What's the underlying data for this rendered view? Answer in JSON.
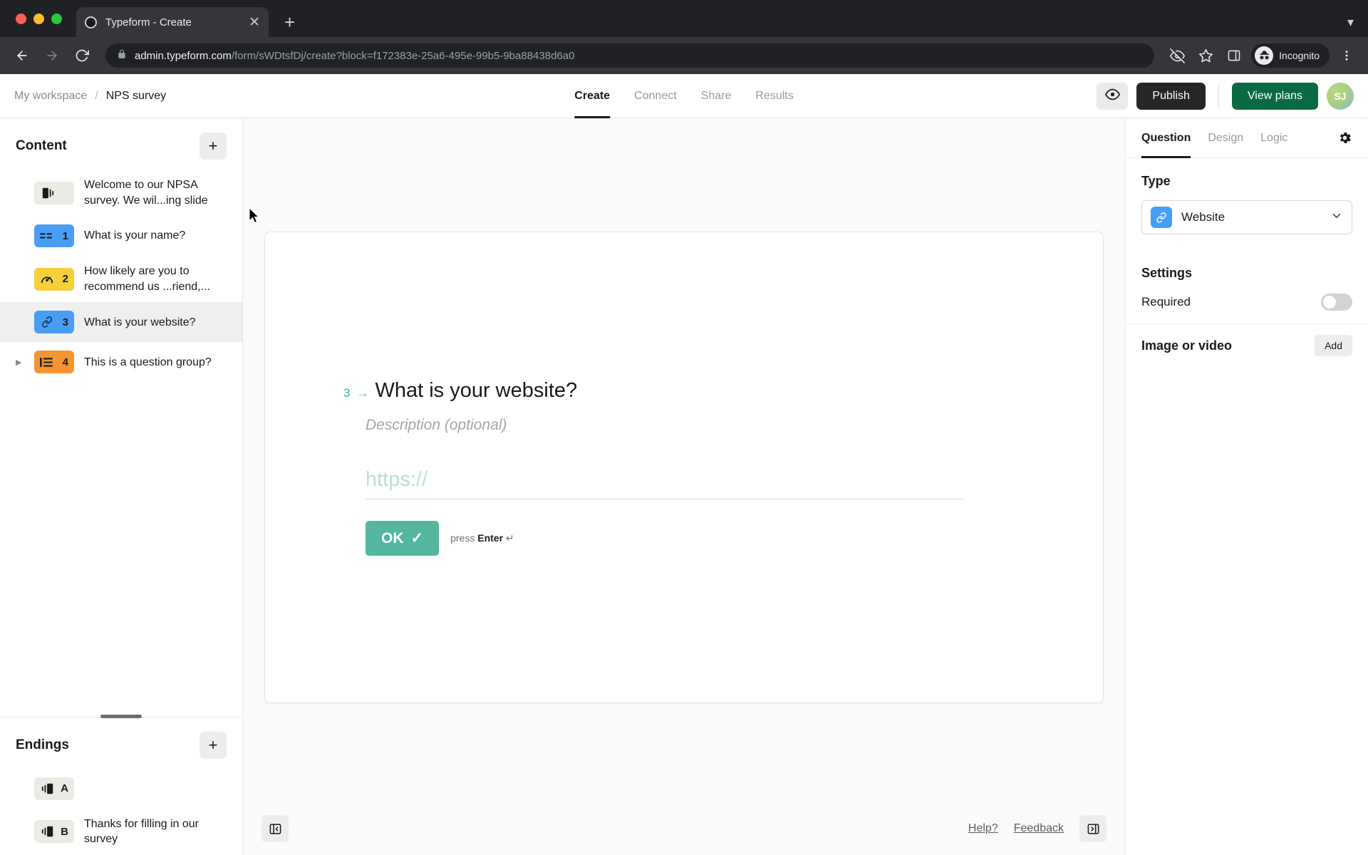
{
  "browser": {
    "tab_title": "Typeform - Create",
    "url_host": "admin.typeform.com",
    "url_path": "/form/sWDtsfDj/create?block=f172383e-25a6-495e-99b5-9ba88438d6a0",
    "profile_label": "Incognito",
    "icons": {
      "back": "back-arrow-icon",
      "forward": "forward-arrow-icon",
      "reload": "reload-icon",
      "lock": "lock-icon",
      "tracking_off": "eye-off-icon",
      "bookmark": "star-icon",
      "side_panel": "side-panel-icon",
      "menu": "kebab-menu-icon",
      "new_tab": "plus-icon",
      "close_tab": "close-icon",
      "tabstrip_menu": "chevron-down-icon"
    }
  },
  "header": {
    "breadcrumb_workspace": "My workspace",
    "breadcrumb_separator": "/",
    "breadcrumb_form": "NPS survey",
    "tabs": [
      {
        "label": "Create",
        "active": true
      },
      {
        "label": "Connect",
        "active": false
      },
      {
        "label": "Share",
        "active": false
      },
      {
        "label": "Results",
        "active": false
      }
    ],
    "preview_icon": "eye-icon",
    "publish_label": "Publish",
    "view_plans_label": "View plans",
    "avatar_initials": "SJ"
  },
  "sidebar": {
    "content_title": "Content",
    "add_label": "+",
    "content_items": [
      {
        "badge": "",
        "icon": "welcome-slide-icon",
        "color": "grey",
        "label": "Welcome to our NPSA survey. We wil...ing slide",
        "selected": false,
        "expandable": false
      },
      {
        "badge": "1",
        "icon": "short-text-icon",
        "color": "blue",
        "label": "What is your name?",
        "selected": false,
        "expandable": false
      },
      {
        "badge": "2",
        "icon": "opinion-scale-icon",
        "color": "yellow",
        "label": "How likely are you to recommend us ...riend,...",
        "selected": false,
        "expandable": false
      },
      {
        "badge": "3",
        "icon": "website-link-icon",
        "color": "blue",
        "label": "What is your website?",
        "selected": true,
        "expandable": false
      },
      {
        "badge": "4",
        "icon": "question-group-icon",
        "color": "orange",
        "label": "This is a question group?",
        "selected": false,
        "expandable": true
      }
    ],
    "endings_title": "Endings",
    "endings_add_label": "+",
    "ending_items": [
      {
        "badge": "A",
        "icon": "ending-slide-icon",
        "color": "grey",
        "label": ""
      },
      {
        "badge": "B",
        "icon": "ending-slide-icon",
        "color": "grey",
        "label": "Thanks for filling in our survey"
      }
    ]
  },
  "canvas": {
    "question_number": "3",
    "question_arrow": "→",
    "question_title": "What is your website?",
    "description_placeholder": "Description (optional)",
    "answer_placeholder": "https://",
    "ok_label": "OK",
    "ok_check": "✓",
    "press_enter_prefix": "press",
    "press_enter_key": "Enter",
    "press_enter_symbol": "↵",
    "footer": {
      "collapse_left_icon": "collapse-left-panel-icon",
      "help_label": "Help?",
      "feedback_label": "Feedback",
      "collapse_right_icon": "collapse-right-panel-icon"
    }
  },
  "right_panel": {
    "tabs": [
      {
        "label": "Question",
        "active": true
      },
      {
        "label": "Design",
        "active": false
      },
      {
        "label": "Logic",
        "active": false
      }
    ],
    "gear_icon": "gear-icon",
    "type_label": "Type",
    "type_value": "Website",
    "type_icon": "website-link-icon",
    "settings_label": "Settings",
    "required_label": "Required",
    "required_on": false,
    "image_or_video_label": "Image or video",
    "add_label": "Add"
  },
  "colors": {
    "accent_green": "#0a6b43",
    "publish_dark": "#262627",
    "chip_blue": "#4a9df5",
    "chip_yellow": "#f7cf3b",
    "chip_orange": "#f59432",
    "ok_teal": "#54b6a0",
    "question_num_teal": "#3ab795"
  }
}
